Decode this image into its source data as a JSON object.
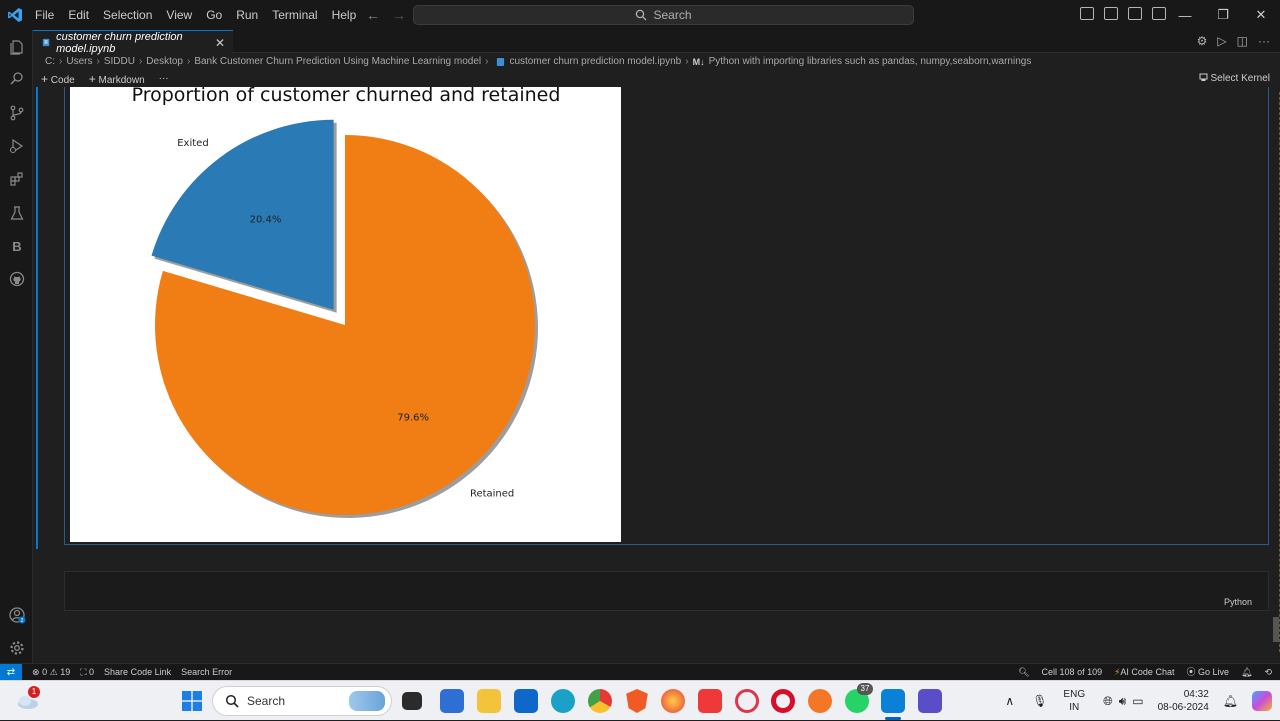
{
  "menu": [
    "File",
    "Edit",
    "Selection",
    "View",
    "Go",
    "Run",
    "Terminal",
    "Help"
  ],
  "search": {
    "label": "Search"
  },
  "tab": {
    "label": "customer churn prediction model.ipynb"
  },
  "breadcrumb": {
    "items": [
      "C:",
      "Users",
      "SIDDU",
      "Desktop",
      "Bank Customer Churn Prediction Using Machine Learning model",
      "customer churn prediction model.ipynb",
      "Python with importing libraries such as pandas, numpy,seaborn,warnings"
    ],
    "md_badge": "M↓"
  },
  "toolbar": {
    "code": "Code",
    "markdown": "Markdown",
    "more": "···",
    "kernel": "Select Kernel"
  },
  "chart_data": {
    "type": "pie",
    "title": "Proportion of customer churned and retained",
    "labels": [
      "Exited",
      "Retained"
    ],
    "values": [
      20.4,
      79.6
    ],
    "value_labels": [
      "20.4%",
      "79.6%"
    ],
    "colors": [
      "#2a7ab5",
      "#f07e14"
    ],
    "explode": [
      0.1,
      0
    ],
    "shadow": true
  },
  "cell": {
    "language": "Python"
  },
  "status": {
    "errors": "0",
    "warnings": "19",
    "ports": "0",
    "share": "Share Code Link",
    "search_error": "Search Error",
    "cell_pos": "Cell 108 of 109",
    "ai_chat": "AI Code Chat",
    "go_live": "Go Live"
  },
  "taskbar": {
    "search": "Search",
    "lang1": "ENG",
    "lang2": "IN",
    "time": "04:32",
    "date": "08-06-2024",
    "whatsapp_badge": "37",
    "weather_badge": "1"
  }
}
